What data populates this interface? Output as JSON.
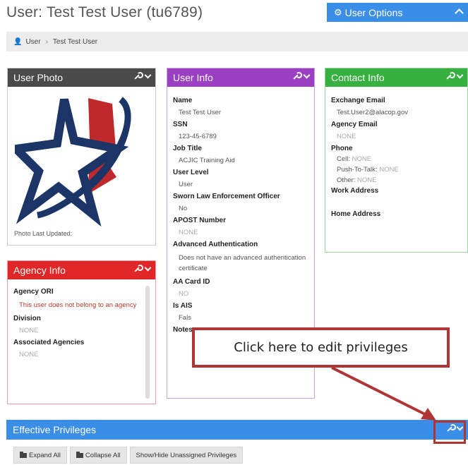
{
  "header": {
    "title": "User: Test Test User (tu6789)",
    "user_options_label": "User Options"
  },
  "breadcrumb": {
    "items": [
      "User",
      "Test Test User"
    ]
  },
  "user_photo": {
    "title": "User Photo",
    "caption": "Photo Last Updated:"
  },
  "agency_info": {
    "title": "Agency Info",
    "fields": {
      "ori_label": "Agency ORI",
      "ori_value": "This user does not belong to an agency",
      "division_label": "Division",
      "division_value": "NONE",
      "assoc_label": "Associated Agencies",
      "assoc_value": "NONE"
    }
  },
  "user_info": {
    "title": "User Info",
    "fields": [
      {
        "label": "Name",
        "value": "Test Test User"
      },
      {
        "label": "SSN",
        "value": "123-45-6789"
      },
      {
        "label": "Job Title",
        "value": "ACJIC Training Aid"
      },
      {
        "label": "User Level",
        "value": "User"
      },
      {
        "label": "Sworn Law Enforcement Officer",
        "value": "No"
      },
      {
        "label": "APOST Number",
        "value": "NONE"
      },
      {
        "label": "Advanced Authentication",
        "value": "Does not have an advanced authentication certificate"
      },
      {
        "label": "AA Card ID",
        "value": "NO"
      },
      {
        "label": "Is AIS",
        "value": "Fals"
      },
      {
        "label": "Notes",
        "value": ""
      }
    ]
  },
  "contact_info": {
    "title": "Contact Info",
    "exchange_label": "Exchange Email",
    "exchange_value": "Test.User2@alacop.gov",
    "agency_email_label": "Agency Email",
    "agency_email_value": "NONE",
    "phone_label": "Phone",
    "cell_label": "Cell:",
    "cell_value": "NONE",
    "ptt_label": "Push-To-Talk:",
    "ptt_value": "NONE",
    "other_label": "Other:",
    "other_value": "NONE",
    "work_address_label": "Work Address",
    "home_address_label": "Home Address"
  },
  "privileges": {
    "title": "Effective Privileges",
    "expand_label": "Expand All",
    "collapse_label": "Collapse All",
    "show_hide_label": "Show/Hide Unassigned Privileges"
  },
  "annotation": {
    "callout_text": "Click here to edit privileges"
  },
  "colors": {
    "user_photo": "#4a4a4a",
    "user_info": "#9b3fc3",
    "contact_info": "#36b13f",
    "agency_info": "#e02626",
    "primary_blue": "#3b8ee8",
    "callout_border": "#b03535"
  }
}
